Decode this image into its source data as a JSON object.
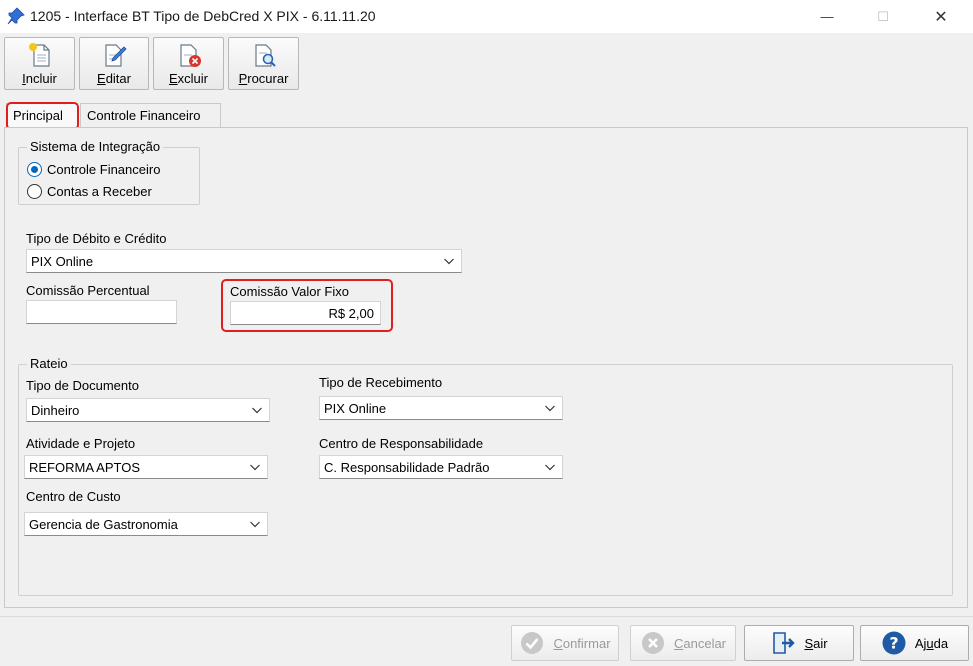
{
  "window": {
    "title": "1205 - Interface BT Tipo de DebCred X PIX - 6.11.11.20",
    "minimize_glyph": "—",
    "maximize_glyph": "☐",
    "close_glyph": "✕",
    "icon": "pushpin-icon"
  },
  "toolbar": {
    "incluir": {
      "label_u": "I",
      "label_rest": "ncluir",
      "icon": "new-document-icon"
    },
    "editar": {
      "label_u": "E",
      "label_rest": "ditar",
      "icon": "edit-document-icon"
    },
    "excluir": {
      "label_u": "E",
      "label_rest": "xcluir",
      "icon": "delete-document-icon"
    },
    "procurar": {
      "label_u": "P",
      "label_rest": "rocurar",
      "icon": "search-document-icon"
    }
  },
  "tabs": [
    {
      "label": "Principal",
      "active": true
    },
    {
      "label": "Controle Financeiro",
      "active": false
    }
  ],
  "sistema_integracao": {
    "legend": "Sistema de Integração",
    "options": [
      {
        "label": "Controle Financeiro",
        "checked": true
      },
      {
        "label": "Contas a Receber",
        "checked": false
      }
    ]
  },
  "tipo_debito_credito": {
    "label": "Tipo de Débito e Crédito",
    "value": "PIX Online"
  },
  "comissao_percentual": {
    "label": "Comissão Percentual",
    "value": ""
  },
  "comissao_valor_fixo": {
    "label": "Comissão Valor Fixo",
    "value": "R$ 2,00"
  },
  "rateio": {
    "legend": "Rateio",
    "tipo_documento": {
      "label": "Tipo de Documento",
      "value": "Dinheiro"
    },
    "tipo_recebimento": {
      "label": "Tipo de Recebimento",
      "value": "PIX Online"
    },
    "atividade_projeto": {
      "label": "Atividade e Projeto",
      "value": "REFORMA APTOS"
    },
    "centro_responsabilidade": {
      "label": "Centro de Responsabilidade",
      "value": "C. Responsabilidade Padrão"
    },
    "centro_custo": {
      "label": "Centro de Custo",
      "value": "Gerencia de Gastronomia"
    }
  },
  "footer": {
    "confirmar": {
      "label_u": "C",
      "label_rest": "onfirmar",
      "enabled": false,
      "icon": "check-circle-icon"
    },
    "cancelar": {
      "label_u": "C",
      "label_rest": "ancelar",
      "enabled": false,
      "icon": "x-circle-icon"
    },
    "sair": {
      "label_u": "S",
      "label_rest": "air",
      "enabled": true,
      "icon": "exit-door-icon"
    },
    "ajuda": {
      "label_pre": "Aj",
      "label_u": "u",
      "label_rest": "da",
      "enabled": true,
      "icon": "help-circle-icon"
    }
  },
  "colors": {
    "accent": "#0067c0",
    "highlight_box": "#e01e1e",
    "help_blue": "#1f5aa6"
  }
}
